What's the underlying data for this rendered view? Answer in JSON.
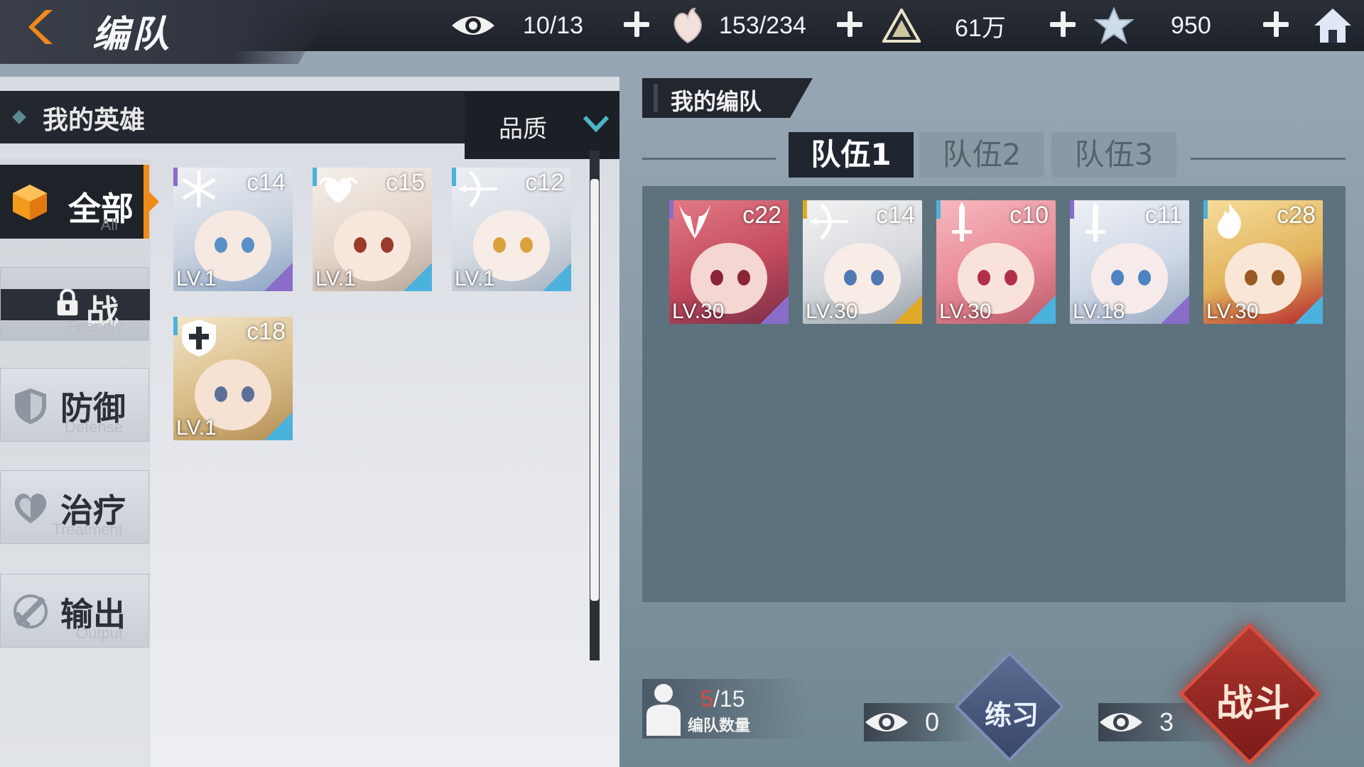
{
  "header": {
    "title": "编队",
    "resources": [
      {
        "icon": "eye-icon",
        "value": "10/13"
      },
      {
        "icon": "heart-flame-icon",
        "value": "153/234"
      },
      {
        "icon": "pyramid-icon",
        "value": "61万"
      },
      {
        "icon": "star-crystal-icon",
        "value": "950"
      }
    ]
  },
  "left": {
    "section_title": "我的英雄",
    "sort_label": "品质",
    "categories": [
      {
        "cn": "全部",
        "en": "All",
        "active": true,
        "icon": "cube-icon"
      },
      {
        "cn": "战",
        "en": "Friendly",
        "active": false,
        "icon": "handshake-lock-icon"
      },
      {
        "cn": "防御",
        "en": "Defense",
        "active": false,
        "icon": "shield-icon"
      },
      {
        "cn": "治疗",
        "en": "Treatment",
        "active": false,
        "icon": "heart-icon"
      },
      {
        "cn": "输出",
        "en": "Output",
        "active": false,
        "icon": "sword-icon"
      }
    ],
    "heroes": [
      {
        "code": "c14",
        "lv": "LV.1",
        "class": "snowflake-icon",
        "rarity": "#8a6cc9"
      },
      {
        "code": "c15",
        "lv": "LV.1",
        "class": "heart-wing-icon",
        "rarity": "#4bb2dd"
      },
      {
        "code": "c12",
        "lv": "LV.1",
        "class": "bow-icon",
        "rarity": "#4bb2dd"
      },
      {
        "code": "c18",
        "lv": "LV.1",
        "class": "shield-cross-icon",
        "rarity": "#4bb2dd"
      }
    ]
  },
  "right": {
    "section_title": "我的编队",
    "tabs": [
      "队伍1",
      "队伍2",
      "队伍3"
    ],
    "team": [
      {
        "code": "c22",
        "lv": "LV.30",
        "class": "demon-icon",
        "rarity": "#8a6cc9"
      },
      {
        "code": "c14",
        "lv": "LV.30",
        "class": "bow-icon",
        "rarity": "#e0a826"
      },
      {
        "code": "c10",
        "lv": "LV.30",
        "class": "sword-icon",
        "rarity": "#4bb2dd"
      },
      {
        "code": "c11",
        "lv": "LV.18",
        "class": "sword-icon",
        "rarity": "#8a6cc9"
      },
      {
        "code": "c28",
        "lv": "LV.30",
        "class": "flame-icon",
        "rarity": "#4bb2dd"
      }
    ],
    "team_count_current": "5",
    "team_count_total": "/15",
    "team_count_label": "编队数量",
    "practice_cost": "0",
    "practice_label": "练习",
    "battle_cost": "3",
    "battle_label": "战斗"
  }
}
